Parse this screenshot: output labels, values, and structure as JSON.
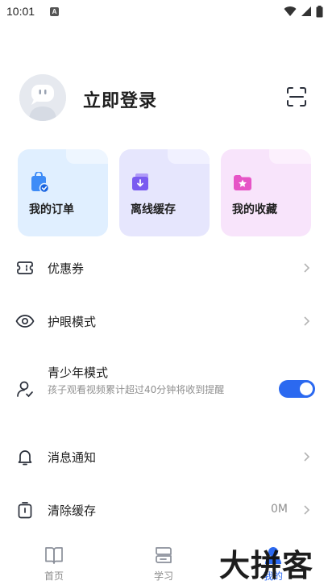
{
  "status_bar": {
    "time": "10:01",
    "notification_badge": "A"
  },
  "profile": {
    "login_label": "立即登录"
  },
  "cards": [
    {
      "label": "我的订单",
      "icon": "order-bag-icon",
      "color": "#e0efff"
    },
    {
      "label": "离线缓存",
      "icon": "download-folder-icon",
      "color": "#e6e6fd"
    },
    {
      "label": "我的收藏",
      "icon": "favorite-star-icon",
      "color": "#f8e4fb"
    }
  ],
  "menu": {
    "coupon": {
      "label": "优惠券"
    },
    "eye_mode": {
      "label": "护眼模式"
    },
    "teen_mode": {
      "label": "青少年模式",
      "desc": "孩子观看视频累计超过40分钟将收到提醒",
      "enabled": true
    },
    "notifications": {
      "label": "消息通知"
    },
    "clear_cache": {
      "label": "清除缓存",
      "value": "0M"
    }
  },
  "bottom_nav": {
    "items": [
      {
        "label": "首页",
        "icon": "home-book-icon"
      },
      {
        "label": "学习",
        "icon": "study-icon"
      },
      {
        "label": "我的",
        "icon": "profile-icon",
        "active": true
      }
    ]
  },
  "watermark": "大拼客",
  "accent_color": "#2b69f0"
}
